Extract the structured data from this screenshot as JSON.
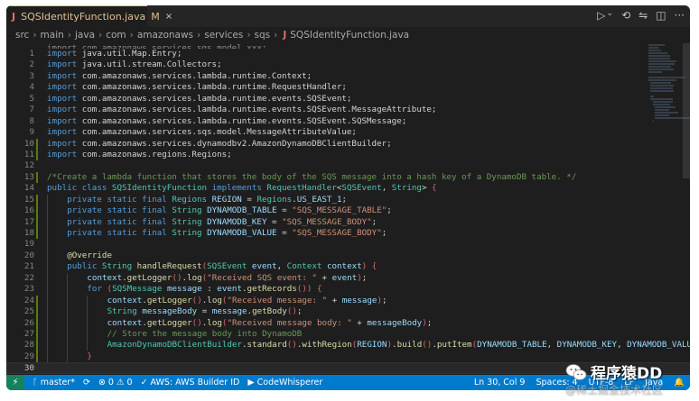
{
  "tab": {
    "icon": "java-file-icon",
    "filename": "SQSIdentityFunction.java",
    "modified": "M",
    "close": "×"
  },
  "toolbar": [
    "run-icon",
    "compare-changes-icon",
    "open-changes-icon",
    "split-editor-icon",
    "more-actions-icon"
  ],
  "breadcrumb": [
    "src",
    "main",
    "java",
    "com",
    "amazonaws",
    "services",
    "sqs",
    "SQSIdentityFunction.java"
  ],
  "editor": {
    "current_line": 30,
    "lines": [
      {
        "n": "",
        "tokens": [
          [
            "pu",
            "import com.amazonaws.services.sqs.model.xxx;"
          ]
        ],
        "partial": true
      },
      {
        "n": "1",
        "tokens": [
          [
            "kw",
            "import "
          ],
          [
            "pu",
            "java.util.Map.Entry;"
          ]
        ]
      },
      {
        "n": "2",
        "tokens": [
          [
            "kw",
            "import "
          ],
          [
            "pu",
            "java.util.stream.Collectors;"
          ]
        ]
      },
      {
        "n": "3",
        "tokens": [
          [
            "kw",
            "import "
          ],
          [
            "pu",
            "com.amazonaws.services.lambda.runtime.Context;"
          ]
        ]
      },
      {
        "n": "4",
        "tokens": [
          [
            "kw",
            "import "
          ],
          [
            "pu",
            "com.amazonaws.services.lambda.runtime.RequestHandler;"
          ]
        ]
      },
      {
        "n": "5",
        "tokens": [
          [
            "kw",
            "import "
          ],
          [
            "pu",
            "com.amazonaws.services.lambda.runtime.events.SQSEvent;"
          ]
        ]
      },
      {
        "n": "7",
        "tokens": [
          [
            "kw",
            "import "
          ],
          [
            "pu",
            "com.amazonaws.services.lambda.runtime.events.SQSEvent.MessageAttribute;"
          ]
        ]
      },
      {
        "n": "8",
        "tokens": [
          [
            "kw",
            "import "
          ],
          [
            "pu",
            "com.amazonaws.services.lambda.runtime.events.SQSEvent.SQSMessage;"
          ]
        ]
      },
      {
        "n": "9",
        "tokens": [
          [
            "kw",
            "import "
          ],
          [
            "pu",
            "com.amazonaws.services.sqs.model.MessageAttributeValue;"
          ]
        ]
      },
      {
        "n": "10",
        "tokens": [
          [
            "kw",
            "import "
          ],
          [
            "pu",
            "com.amazonaws.services.dynamodbv2.AmazonDynamoDBClientBuilder;"
          ]
        ],
        "added": true
      },
      {
        "n": "11",
        "tokens": [
          [
            "kw",
            "import "
          ],
          [
            "pu",
            "com.amazonaws.regions.Regions;"
          ]
        ],
        "added": true
      },
      {
        "n": "12",
        "tokens": []
      },
      {
        "n": "13",
        "tokens": [
          [
            "cm",
            "/*Create a lambda function that stores the body of the SQS message into a hash key of a DynamoDB table. */"
          ]
        ],
        "added": true
      },
      {
        "n": "14",
        "tokens": [
          [
            "kw",
            "public class "
          ],
          [
            "ty",
            "SQSIdentityFunction "
          ],
          [
            "kw",
            "implements "
          ],
          [
            "ty",
            "RequestHandler"
          ],
          [
            "pu",
            "<"
          ],
          [
            "ty",
            "SQSEvent"
          ],
          [
            "pu",
            ", "
          ],
          [
            "ty",
            "String"
          ],
          [
            "pu",
            "> "
          ],
          [
            "br",
            "{"
          ]
        ]
      },
      {
        "n": "15",
        "indent": 4,
        "tokens": [
          [
            "kw",
            "private static final "
          ],
          [
            "ty",
            "Regions "
          ],
          [
            "vr",
            "REGION"
          ],
          [
            "pu",
            " = "
          ],
          [
            "ty",
            "Regions"
          ],
          [
            "pu",
            "."
          ],
          [
            "vr",
            "US_EAST_1"
          ],
          [
            "pu",
            ";"
          ]
        ],
        "added": true
      },
      {
        "n": "16",
        "indent": 4,
        "tokens": [
          [
            "kw",
            "private static final "
          ],
          [
            "ty",
            "String "
          ],
          [
            "vr",
            "DYNAMODB_TABLE"
          ],
          [
            "pu",
            " = "
          ],
          [
            "st",
            "\"SQS_MESSAGE_TABLE\""
          ],
          [
            "pu",
            ";"
          ]
        ],
        "added": true
      },
      {
        "n": "17",
        "indent": 4,
        "tokens": [
          [
            "kw",
            "private static final "
          ],
          [
            "ty",
            "String "
          ],
          [
            "vr",
            "DYNAMODB_KEY"
          ],
          [
            "pu",
            " = "
          ],
          [
            "st",
            "\"SQS_MESSAGE_BODY\""
          ],
          [
            "pu",
            ";"
          ]
        ],
        "added": true
      },
      {
        "n": "18",
        "indent": 4,
        "tokens": [
          [
            "kw",
            "private static final "
          ],
          [
            "ty",
            "String "
          ],
          [
            "vr",
            "DYNAMODB_VALUE"
          ],
          [
            "pu",
            " = "
          ],
          [
            "st",
            "\"SQS_MESSAGE_BODY\""
          ],
          [
            "pu",
            ";"
          ]
        ],
        "added": true
      },
      {
        "n": "19",
        "tokens": []
      },
      {
        "n": "20",
        "indent": 4,
        "tokens": [
          [
            "an",
            "@Override"
          ]
        ]
      },
      {
        "n": "21",
        "indent": 4,
        "tokens": [
          [
            "kw",
            "public "
          ],
          [
            "ty",
            "String "
          ],
          [
            "fn",
            "handleRequest"
          ],
          [
            "br",
            "("
          ],
          [
            "ty",
            "SQSEvent "
          ],
          [
            "vr",
            "event"
          ],
          [
            "pu",
            ", "
          ],
          [
            "ty",
            "Context "
          ],
          [
            "vr",
            "context"
          ],
          [
            "br",
            ")"
          ],
          [
            "pu",
            " "
          ],
          [
            "br",
            "{"
          ]
        ]
      },
      {
        "n": "22",
        "indent": 8,
        "tokens": [
          [
            "vr",
            "context"
          ],
          [
            "pu",
            "."
          ],
          [
            "fn",
            "getLogger"
          ],
          [
            "br",
            "()"
          ],
          [
            "pu",
            "."
          ],
          [
            "fn",
            "log"
          ],
          [
            "br",
            "("
          ],
          [
            "st",
            "\"Received SQS event: \""
          ],
          [
            "pu",
            " + "
          ],
          [
            "vr",
            "event"
          ],
          [
            "br",
            ")"
          ],
          [
            "pu",
            ";"
          ]
        ]
      },
      {
        "n": "23",
        "indent": 8,
        "tokens": [
          [
            "kw",
            "for "
          ],
          [
            "br",
            "("
          ],
          [
            "ty",
            "SQSMessage "
          ],
          [
            "vr",
            "message"
          ],
          [
            "pu",
            " : "
          ],
          [
            "vr",
            "event"
          ],
          [
            "pu",
            "."
          ],
          [
            "fn",
            "getRecords"
          ],
          [
            "br",
            "()"
          ],
          [
            "br",
            ")"
          ],
          [
            "pu",
            " "
          ],
          [
            "br",
            "{"
          ]
        ]
      },
      {
        "n": "24",
        "indent": 12,
        "tokens": [
          [
            "vr",
            "context"
          ],
          [
            "pu",
            "."
          ],
          [
            "fn",
            "getLogger"
          ],
          [
            "br",
            "()"
          ],
          [
            "pu",
            "."
          ],
          [
            "fn",
            "log"
          ],
          [
            "br",
            "("
          ],
          [
            "st",
            "\"Received message: \""
          ],
          [
            "pu",
            " + "
          ],
          [
            "vr",
            "message"
          ],
          [
            "br",
            ")"
          ],
          [
            "pu",
            ";"
          ]
        ],
        "added": true
      },
      {
        "n": "25",
        "indent": 12,
        "tokens": [
          [
            "ty",
            "String "
          ],
          [
            "vr",
            "messageBody"
          ],
          [
            "pu",
            " = "
          ],
          [
            "vr",
            "message"
          ],
          [
            "pu",
            "."
          ],
          [
            "fn",
            "getBody"
          ],
          [
            "br",
            "()"
          ],
          [
            "pu",
            ";"
          ]
        ],
        "added": true
      },
      {
        "n": "26",
        "indent": 12,
        "tokens": [
          [
            "vr",
            "context"
          ],
          [
            "pu",
            "."
          ],
          [
            "fn",
            "getLogger"
          ],
          [
            "br",
            "()"
          ],
          [
            "pu",
            "."
          ],
          [
            "fn",
            "log"
          ],
          [
            "br",
            "("
          ],
          [
            "st",
            "\"Received message body: \""
          ],
          [
            "pu",
            " + "
          ],
          [
            "vr",
            "messageBody"
          ],
          [
            "br",
            ")"
          ],
          [
            "pu",
            ";"
          ]
        ],
        "added": true
      },
      {
        "n": "27",
        "indent": 12,
        "tokens": [
          [
            "cm",
            "// Store the message body into DynamoDB"
          ]
        ],
        "added": true
      },
      {
        "n": "28",
        "indent": 12,
        "tokens": [
          [
            "ty",
            "AmazonDynamoDBClientBuilder"
          ],
          [
            "pu",
            "."
          ],
          [
            "fn",
            "standard"
          ],
          [
            "br",
            "()"
          ],
          [
            "pu",
            "."
          ],
          [
            "fn",
            "withRegion"
          ],
          [
            "br",
            "("
          ],
          [
            "vr",
            "REGION"
          ],
          [
            "br",
            ")"
          ],
          [
            "pu",
            "."
          ],
          [
            "fn",
            "build"
          ],
          [
            "br",
            "()"
          ],
          [
            "pu",
            "."
          ],
          [
            "fn",
            "putItem"
          ],
          [
            "br",
            "("
          ],
          [
            "vr",
            "DYNAMODB_TABLE"
          ],
          [
            "pu",
            ", "
          ],
          [
            "vr",
            "DYNAMODB_KEY"
          ],
          [
            "pu",
            ", "
          ],
          [
            "vr",
            "DYNAMODB_VALUE"
          ],
          [
            "br",
            ")"
          ],
          [
            "pu",
            ";"
          ]
        ],
        "added": true
      },
      {
        "n": "29",
        "indent": 8,
        "tokens": [
          [
            "br",
            "}"
          ]
        ],
        "added": true
      },
      {
        "n": "30",
        "tokens": []
      },
      {
        "n": "31",
        "tokens": []
      }
    ]
  },
  "statusbar": {
    "remote_icon": "remote-icon",
    "branch": "master*",
    "sync_icon": "sync-icon",
    "problems": "0 ⚠ 0",
    "aws": "AWS: AWS Builder ID",
    "codewhisperer": "CodeWhisperer",
    "position": "Ln 30, Col 9",
    "spaces": "Spaces: 4",
    "encoding": "UTF-8",
    "eol": "LF",
    "language": "Java"
  },
  "watermark": {
    "title": "程序猿DD",
    "subtitle": "@稀土掘金技术社区"
  },
  "colors": {
    "statusbar": "#007acc",
    "editor_bg": "#1e1e1e",
    "keyword": "#569cd6",
    "type": "#4ec9b0",
    "string": "#ce9178",
    "comment": "#6a9955"
  }
}
